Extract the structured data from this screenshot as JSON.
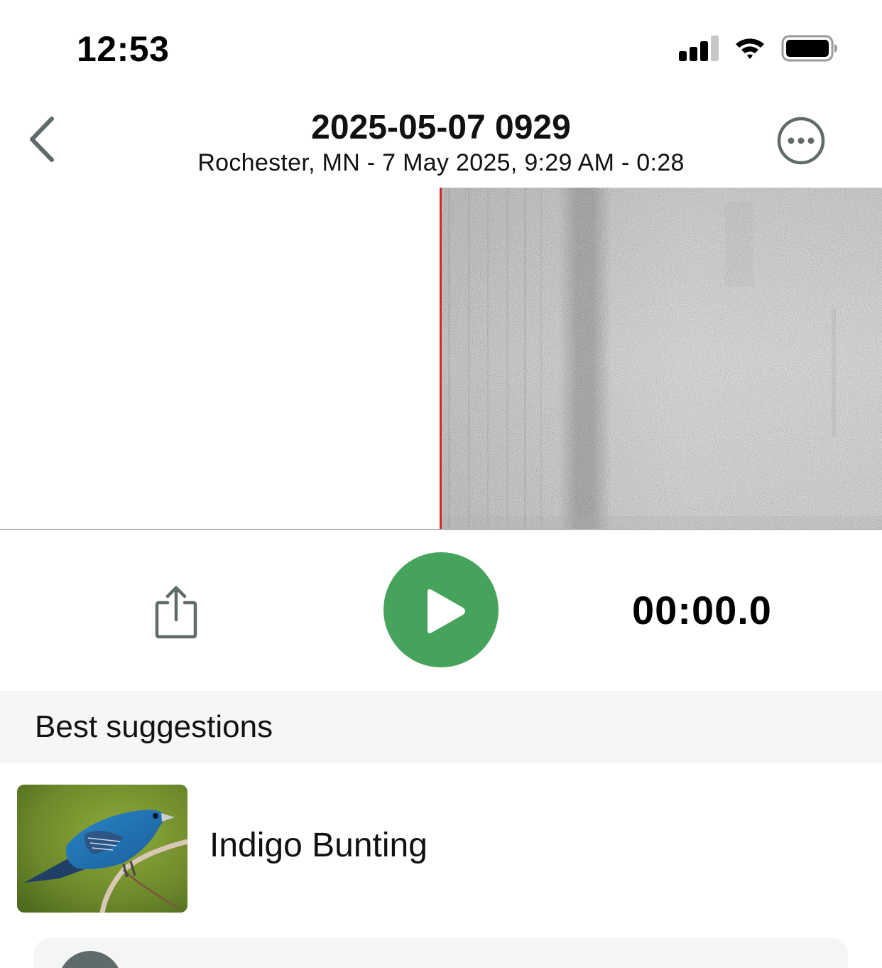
{
  "status_bar": {
    "time": "12:53",
    "icons": [
      "cellular-signal-icon",
      "wifi-icon",
      "battery-icon"
    ]
  },
  "nav": {
    "back_icon": "chevron-left-icon",
    "title": "2025-05-07 0929",
    "subtitle": "Rochester, MN - 7 May 2025, 9:29 AM - 0:28",
    "more_icon": "ellipsis-circle-icon"
  },
  "player": {
    "share_icon": "share-icon",
    "play_icon": "play-icon",
    "elapsed": "00:00.0",
    "accent_color": "#45a35b",
    "playhead_color": "#d7262b",
    "progress_fraction": 0
  },
  "suggestions": {
    "header": "Best suggestions",
    "items": [
      {
        "name": "Indigo Bunting"
      }
    ]
  }
}
